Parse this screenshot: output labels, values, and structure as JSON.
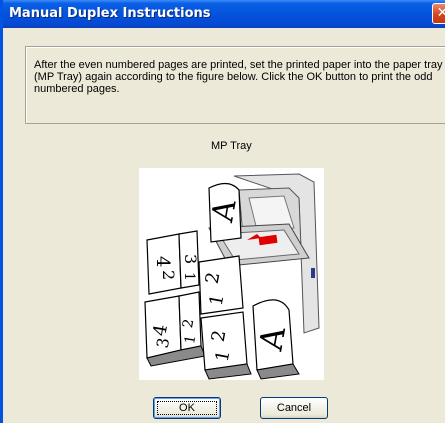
{
  "window": {
    "title": "Manual Duplex Instructions",
    "close_glyph": "✕"
  },
  "instructions": {
    "text": "After the even numbered pages are printed, set the printed paper into the paper tray (MP Tray) again according to the figure below. Click the OK button to print the odd numbered pages."
  },
  "figure": {
    "label": "MP Tray",
    "glyphs": [
      "A",
      "2",
      "1",
      "4",
      "3",
      "2",
      "1",
      "2",
      "1",
      "4",
      "3",
      "2",
      "1",
      "A"
    ]
  },
  "buttons": {
    "ok": "OK",
    "cancel": "Cancel"
  },
  "colors": {
    "titlebar": "#0553dc",
    "close": "#d6451c",
    "dialog_bg": "#ece9d8"
  }
}
